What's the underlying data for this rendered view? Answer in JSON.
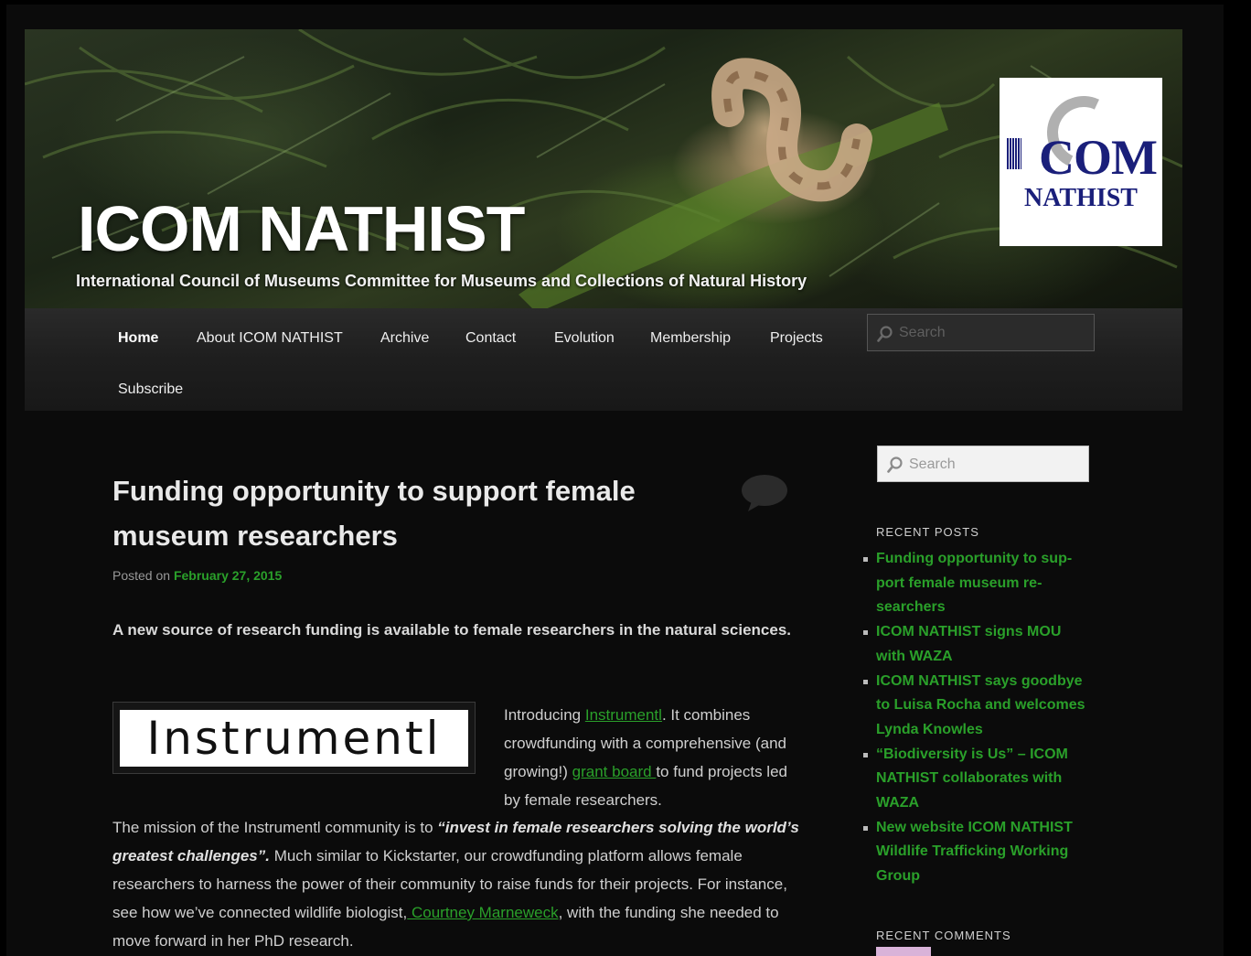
{
  "site": {
    "title": "ICOM NATHIST",
    "description": "International Council of Museums Committee for Museums and Collections of Natural History",
    "logo": {
      "line1": "COM",
      "line2": "NATHIST"
    }
  },
  "nav": {
    "items": [
      {
        "label": "Home",
        "active": true
      },
      {
        "label": "About ICOM NATHIST"
      },
      {
        "label": "Archive"
      },
      {
        "label": "Contact"
      },
      {
        "label": "Evolution"
      },
      {
        "label": "Membership"
      },
      {
        "label": "Projects"
      },
      {
        "label": "Subscribe"
      }
    ],
    "search_placeholder": "Search"
  },
  "post": {
    "title": "Funding opportunity to support female museum researchers",
    "posted_on": "Posted on",
    "date": "February 27, 2015",
    "lead": "A new source of research funding is available to female researchers in the natural sciences.",
    "image_text": "Instrumentl",
    "intro": {
      "t1": "Introducing ",
      "link1": "Instrumentl",
      "t2": ". It combines crowdfunding with a comprehensive (and growing!) ",
      "link2": "grant board ",
      "t3": "to fund projects led by female researchers."
    },
    "mission": {
      "t1": "The mission of the Instrumentl community is to ",
      "quote": "“invest in female researchers solving the world’s greatest challenges”.",
      "t2": " Much similar to Kickstarter, our crowdfunding platform allows female researchers to harness the power of their community to raise funds for their projects. For instance, see how we’ve connected wildlife biologist,",
      "link": " Courtney Marneweck",
      "t3": ", with the funding she needed to move forward in her PhD research."
    }
  },
  "sidebar": {
    "search_placeholder": "Search",
    "recent_posts_heading": "RECENT POSTS",
    "recent_posts": [
      "Funding opportunity to sup­port female museum re­searchers",
      "ICOM NATHIST signs MOU with WAZA",
      "ICOM NATHIST says goodbye to Luisa Rocha and wel­comes Lynda Knowles",
      "“Biodiversity is Us” – ICOM NATHIST collaborates with WAZA",
      "New website ICOM NATHIST Wildlife Trafficking Work­ing Group"
    ],
    "recent_comments_heading": "RECENT COMMENTS"
  },
  "colors": {
    "link": "#2aa02a",
    "background": "#0b0b0b",
    "nav": "#222222"
  }
}
